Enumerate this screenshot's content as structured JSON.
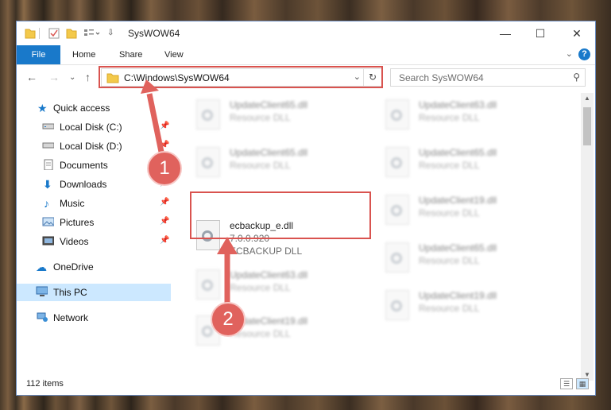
{
  "window": {
    "title": "SysWOW64",
    "min": "—",
    "max": "☐",
    "close": "✕"
  },
  "ribbon": {
    "tabs": [
      "File",
      "Home",
      "Share",
      "View"
    ]
  },
  "address": {
    "path": "C:\\Windows\\SysWOW64",
    "dropdown": "⌄",
    "refresh": "↻"
  },
  "search": {
    "placeholder": "Search SysWOW64"
  },
  "nav": {
    "items": [
      {
        "label": "Quick access",
        "pinned": false
      },
      {
        "label": "Local Disk (C:)",
        "pinned": true
      },
      {
        "label": "Local Disk (D:)",
        "pinned": true
      },
      {
        "label": "Documents",
        "pinned": true
      },
      {
        "label": "Downloads",
        "pinned": true
      },
      {
        "label": "Music",
        "pinned": true
      },
      {
        "label": "Pictures",
        "pinned": true
      },
      {
        "label": "Videos",
        "pinned": true
      },
      {
        "label": "OneDrive",
        "pinned": false
      },
      {
        "label": "This PC",
        "pinned": false
      },
      {
        "label": "Network",
        "pinned": false
      }
    ]
  },
  "files": {
    "highlighted": {
      "name": "ecbackup_e.dll",
      "version": "7.0.0.920",
      "description": "ECBACKUP DLL"
    },
    "blurred": [
      {
        "name": "UpdateClient65.dll",
        "desc": "Resource DLL"
      },
      {
        "name": "UpdateClient63.dll",
        "desc": "Resource DLL"
      },
      {
        "name": "UpdateClient65.dll",
        "desc": "Resource DLL"
      },
      {
        "name": "UpdateClient65.dll",
        "desc": "Resource DLL"
      },
      {
        "name": "UpdateClient19.dll",
        "desc": "Resource DLL"
      },
      {
        "name": "UpdateClient63.dll",
        "desc": "Resource DLL"
      },
      {
        "name": "UpdateClient65.dll",
        "desc": "Resource DLL"
      },
      {
        "name": "UpdateClient19.dll",
        "desc": "Resource DLL"
      },
      {
        "name": "UpdateClient19.dll",
        "desc": "Resource DLL"
      }
    ]
  },
  "status": {
    "count": "112 items"
  },
  "callouts": [
    "1",
    "2"
  ],
  "colors": {
    "accent": "#1979ca",
    "highlight": "#d9534f",
    "callout": "#e0625d",
    "selected": "#cce8ff"
  }
}
